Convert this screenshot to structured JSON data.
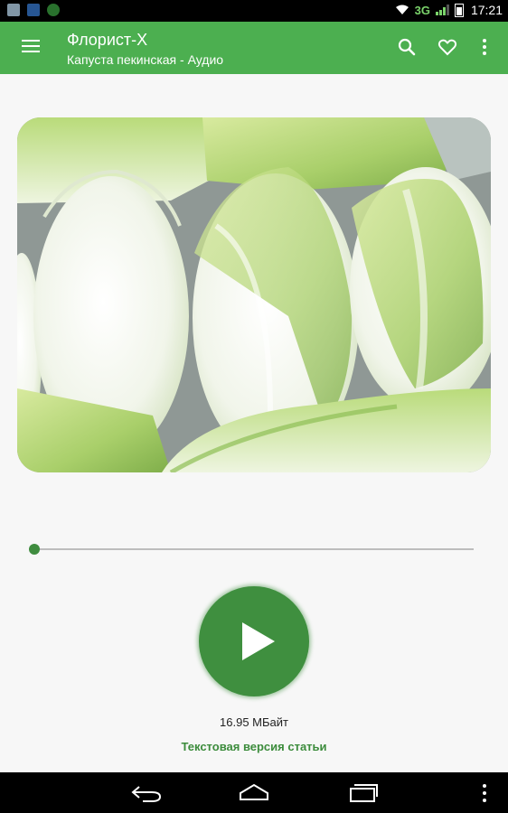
{
  "status_bar": {
    "time": "17:21",
    "network": "3G",
    "icons": [
      "gallery-icon",
      "app-icon",
      "circle-app-icon",
      "wifi-icon",
      "signal-icon",
      "battery-icon"
    ]
  },
  "app_bar": {
    "title": "Флорист-Х",
    "subtitle": "Капуста пекинская - Аудио",
    "color": "#4caf50",
    "icons": [
      "menu-icon",
      "search-icon",
      "heart-icon",
      "more-vert-icon"
    ]
  },
  "player": {
    "progress_fraction": 0.0,
    "file_size": "16.95 МБайт",
    "text_version_link": "Текстовая версия статьи",
    "accent": "#3f8f3f"
  },
  "nav_bar": {
    "icons": [
      "back-icon",
      "home-icon",
      "recent-apps-icon",
      "more-vert-icon"
    ]
  }
}
